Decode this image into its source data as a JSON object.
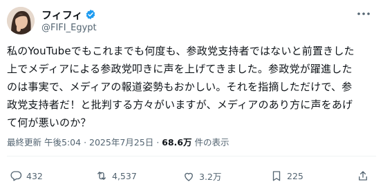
{
  "user": {
    "display_name": "フィフィ",
    "handle": "@FIFI_Egypt",
    "verified_icon": "verified-badge-icon",
    "brand_color": "#1d9bf0"
  },
  "tweet": {
    "lines": [
      "私のYouTubeでもこれまでも何度も、参政党支持者ではないと前置きした",
      "上でメディアによる参政党叩きに声を上げてきました。参政党が躍進した",
      "のは事実で、メディアの報道姿勢もおかしい。それを指摘しただけで、参",
      "政党支持者だ！と批判する方々がいますが、メディアのあり方に声をあげ",
      "て何が悪いのか？"
    ]
  },
  "meta": {
    "updated_label": "最終更新",
    "time": "午後5:04",
    "separator": "·",
    "date": "2025年7月25日",
    "views_count": "68.6万",
    "views_label": "件の表示"
  },
  "actions": {
    "reply_count": "432",
    "retweet_count": "4,537",
    "like_count": "3.2万",
    "bookmark_count": "225"
  }
}
